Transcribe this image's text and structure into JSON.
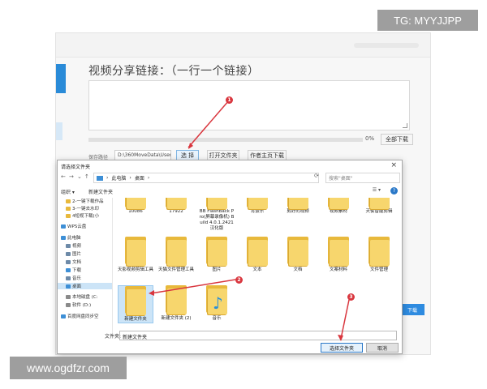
{
  "app": {
    "share_title": "视频分享链接：（一行一个链接）",
    "progress_percent": 0,
    "progress_label": "0%",
    "download_all": "全部下载",
    "save_path_label": "保存路径",
    "save_path_value": "D:\\360MoveData\\Users\\",
    "choose_btn": "选 择",
    "open_folder_btn": "打开文件夹",
    "author_download_btn": "作者主页下载",
    "blue_btn": "下载"
  },
  "dialog": {
    "title": "请选择文件夹",
    "breadcrumb": [
      "此电脑",
      "桌面"
    ],
    "search_placeholder": "搜索\"桌面\"",
    "organize": "组织 ▾",
    "new_folder": "新建文件夹",
    "sidebar": [
      {
        "label": "2-一键下载作品",
        "color": "#e8b93c"
      },
      {
        "label": "3-一键去水印",
        "color": "#e8b93c"
      },
      {
        "label": "4短视下载(小",
        "color": "#e8b93c"
      },
      {
        "label": "WPS云盘",
        "color": "#3d8fd6"
      },
      {
        "label": "此电脑",
        "color": "#3d8fd6"
      },
      {
        "label": "视频",
        "color": "#6d8aa8"
      },
      {
        "label": "图片",
        "color": "#6d8aa8"
      },
      {
        "label": "文档",
        "color": "#6d8aa8"
      },
      {
        "label": "下载",
        "color": "#3d8fd6"
      },
      {
        "label": "音乐",
        "color": "#6d8aa8"
      },
      {
        "label": "桌面",
        "color": "#3d8fd6"
      },
      {
        "label": "本地磁盘 (C:",
        "color": "#8a8a8a"
      },
      {
        "label": "软件 (D:)",
        "color": "#8a8a8a"
      },
      {
        "label": "百度网盘同步空",
        "color": "#3d8fd6"
      }
    ],
    "row1": [
      "10086",
      "17922",
      "BB FlashBack Pro(屏幕录像机) Build 4.0.1.2421 汉化版",
      "背景乐",
      "剪好的视频",
      "视频素材",
      "天俊智能剪辑"
    ],
    "row2": [
      "天影视频剪辑工具",
      "天猫文件管理工具",
      "图片",
      "文本",
      "文档",
      "文案材料",
      "文件管理"
    ],
    "row3": [
      "新建文件夹",
      "新建文件夹 (2)",
      "音乐"
    ],
    "filename_label": "文件夹:",
    "filename_value": "新建文件夹",
    "select_btn": "选择文件夹",
    "cancel_btn": "取消"
  },
  "badges": [
    "1",
    "2",
    "3"
  ],
  "watermarks": {
    "tg": "TG: MYYJJPP",
    "site": "www.ogdfzr.com"
  },
  "colors": {
    "folder_front": "#f7d66d",
    "folder_back": "#e8b93c",
    "accent_blue": "#2e8be0",
    "annotation_red": "#d9363e"
  }
}
